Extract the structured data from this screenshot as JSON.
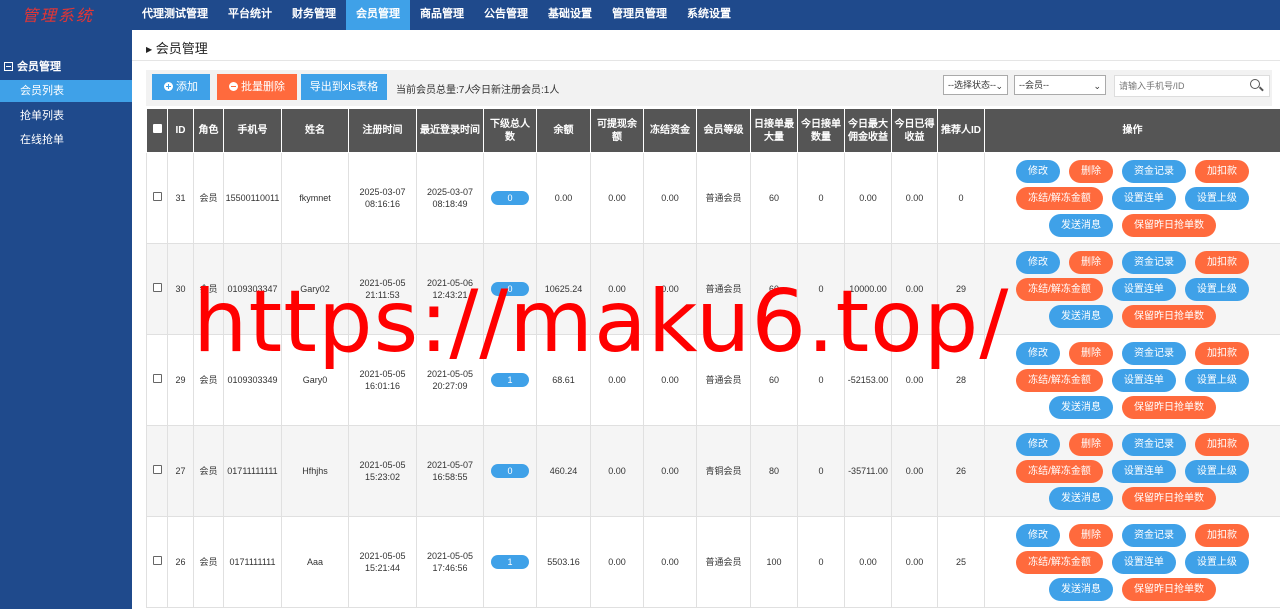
{
  "app": {
    "logo": "管理系统"
  },
  "nav": [
    {
      "label": "代理测试管理",
      "active": false
    },
    {
      "label": "平台统计",
      "active": false
    },
    {
      "label": "财务管理",
      "active": false
    },
    {
      "label": "会员管理",
      "active": true
    },
    {
      "label": "商品管理",
      "active": false
    },
    {
      "label": "公告管理",
      "active": false
    },
    {
      "label": "基础设置",
      "active": false
    },
    {
      "label": "管理员管理",
      "active": false
    },
    {
      "label": "系统设置",
      "active": false
    }
  ],
  "sidebar": {
    "group": "会员管理",
    "items": [
      {
        "label": "会员列表",
        "active": true
      },
      {
        "label": "抢单列表",
        "active": false
      },
      {
        "label": "在线抢单",
        "active": false
      }
    ]
  },
  "breadcrumb": "会员管理",
  "toolbar": {
    "add": "添加",
    "bulk_delete": "批量删除",
    "export": "导出到xls表格",
    "total": "当前会员总量:7人",
    "today": "今日新注册会员:1人",
    "status_select": "--选择状态--",
    "member_select": "--会员--",
    "search_placeholder": "请输入手机号/ID"
  },
  "table": {
    "headers": [
      "ID",
      "角色",
      "手机号",
      "姓名",
      "注册时间",
      "最近登录时间",
      "下级总人数",
      "余额",
      "可提现余额",
      "冻结资金",
      "会员等级",
      "日接单最大量",
      "今日接单数量",
      "今日最大佣金收益",
      "今日已得收益",
      "推荐人ID",
      "操作"
    ],
    "rows": [
      {
        "id": "31",
        "role": "会员",
        "phone": "15500110011",
        "name": "fkymnet",
        "reg_date": "2025-03-07",
        "reg_time": "08:16:16",
        "login_date": "2025-03-07",
        "login_time": "08:18:49",
        "sub": "0",
        "balance": "0.00",
        "withdrawable": "0.00",
        "frozen": "0.00",
        "level": "普通会员",
        "max_orders": "60",
        "today_orders": "0",
        "max_commission": "0.00",
        "earned": "0.00",
        "referrer": "0"
      },
      {
        "id": "30",
        "role": "会员",
        "phone": "0109303347",
        "name": "Gary02",
        "reg_date": "2021-05-05",
        "reg_time": "21:11:53",
        "login_date": "2021-05-06",
        "login_time": "12:43:21",
        "sub": "0",
        "balance": "10625.24",
        "withdrawable": "0.00",
        "frozen": "0.00",
        "level": "普通会员",
        "max_orders": "60",
        "today_orders": "0",
        "max_commission": "10000.00",
        "earned": "0.00",
        "referrer": "29"
      },
      {
        "id": "29",
        "role": "会员",
        "phone": "0109303349",
        "name": "Gary0",
        "reg_date": "2021-05-05",
        "reg_time": "16:01:16",
        "login_date": "2021-05-05",
        "login_time": "20:27:09",
        "sub": "1",
        "balance": "68.61",
        "withdrawable": "0.00",
        "frozen": "0.00",
        "level": "普通会员",
        "max_orders": "60",
        "today_orders": "0",
        "max_commission": "-52153.00",
        "earned": "0.00",
        "referrer": "28"
      },
      {
        "id": "27",
        "role": "会员",
        "phone": "01711111111",
        "name": "Hfhjhs",
        "reg_date": "2021-05-05",
        "reg_time": "15:23:02",
        "login_date": "2021-05-07",
        "login_time": "16:58:55",
        "sub": "0",
        "balance": "460.24",
        "withdrawable": "0.00",
        "frozen": "0.00",
        "level": "青铜会员",
        "max_orders": "80",
        "today_orders": "0",
        "max_commission": "-35711.00",
        "earned": "0.00",
        "referrer": "26"
      },
      {
        "id": "26",
        "role": "会员",
        "phone": "0171111111",
        "name": "Aaa",
        "reg_date": "2021-05-05",
        "reg_time": "15:21:44",
        "login_date": "2021-05-05",
        "login_time": "17:46:56",
        "sub": "1",
        "balance": "5503.16",
        "withdrawable": "0.00",
        "frozen": "0.00",
        "level": "普通会员",
        "max_orders": "100",
        "today_orders": "0",
        "max_commission": "0.00",
        "earned": "0.00",
        "referrer": "25"
      }
    ]
  },
  "actions": {
    "edit": "修改",
    "delete": "删除",
    "funds_log": "资金记录",
    "adjust": "加扣款",
    "freeze": "冻结/解冻金额",
    "set_chain": "设置连单",
    "set_parent": "设置上级",
    "message": "发送消息",
    "keep_orders": "保留昨日抢单数"
  },
  "watermark": "https://maku6.top/",
  "colors": {
    "nav_bg": "#1f4a8c",
    "accent_blue": "#3fa1e8",
    "accent_orange": "#ff6a3d",
    "header_gray": "#555555",
    "watermark": "#ff0000"
  }
}
